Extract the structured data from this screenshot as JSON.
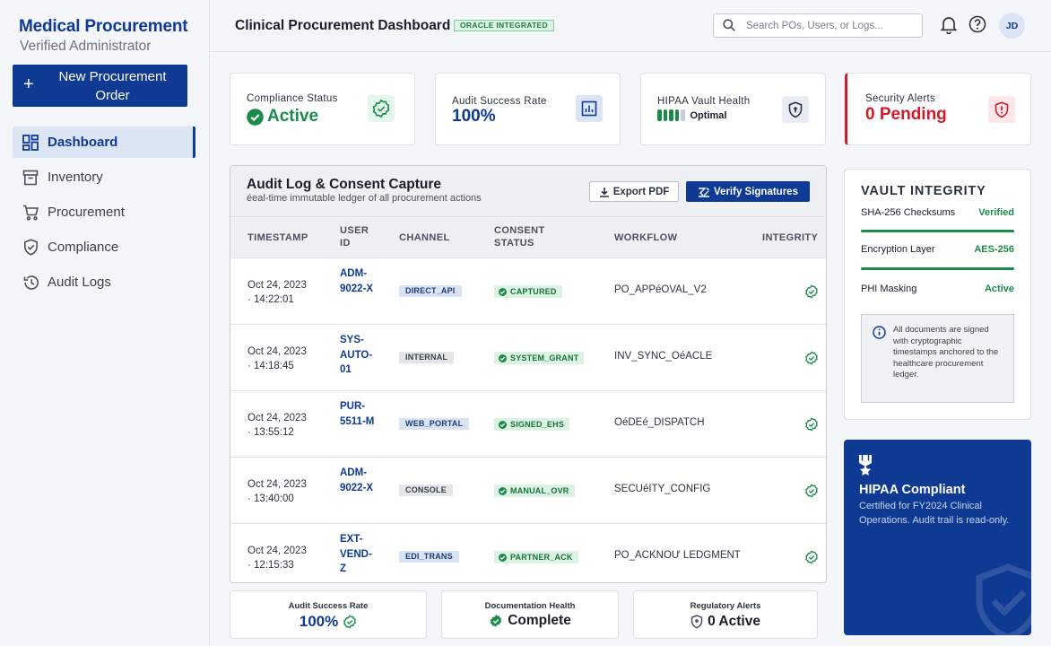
{
  "sidebar": {
    "brand_title": "Medical Procurement",
    "brand_subtitle": "Verified Administrator",
    "new_button": "New Procurement Order",
    "items": [
      {
        "label": "Dashboard",
        "icon": "dashboard-icon",
        "active": true
      },
      {
        "label": "Inventory",
        "icon": "inventory-icon"
      },
      {
        "label": "Procurement",
        "icon": "cart-icon"
      },
      {
        "label": "Compliance",
        "icon": "shield-check-icon"
      },
      {
        "label": "Audit Logs",
        "icon": "history-icon"
      }
    ]
  },
  "header": {
    "title": "Clinical Procurement Dashboard",
    "badge": "ORACLE INTEGRATED",
    "search_placeholder": "Search POs, Users, or Logs...",
    "avatar_initials": "JD"
  },
  "stats": {
    "compliance": {
      "label": "Compliance Status",
      "value": "Active"
    },
    "audit": {
      "label": "Audit Success Rate",
      "value": "100%"
    },
    "hipaa": {
      "label": "HIPAA Vault Health",
      "value": "Optimal",
      "level_segments": 4,
      "level_filled": 4
    },
    "alerts": {
      "label": "Security Alerts",
      "value": "0 Pending"
    }
  },
  "audit": {
    "title": "Audit Log & Consent Capture",
    "subtitle": "éeal-time immutable ledger of all procurement actions",
    "export_label": "Export PDF",
    "verify_label": "Verify Signatures",
    "columns": [
      "TIMESTAMP",
      "USER ID",
      "CHANNEL",
      "CONSENT STATUS",
      "WORKFLOW",
      "INTEGRITY"
    ],
    "rows": [
      {
        "date": "Oct 24, 2023",
        "time": "· 14:22:01",
        "user": "ADM-9022-X",
        "channel": "DIRECT_API",
        "channel_style": "blue",
        "consent": "CAPTURED",
        "workflow": "PO_APPéOVAL_V2"
      },
      {
        "date": "Oct 24, 2023",
        "time": "· 14:18:45",
        "user": "SYS-AUTO-01",
        "channel": "INTERNAL",
        "channel_style": "grey",
        "consent": "SYSTEM_GRANT",
        "workflow": "INV_SYNC_OéACLE"
      },
      {
        "date": "Oct 24, 2023",
        "time": "· 13:55:12",
        "user": "PUR-5511-M",
        "channel": "WEB_PORTAL",
        "channel_style": "blue",
        "consent": "SIGNED_EHS",
        "workflow": "OéDEé_DISPATCH"
      },
      {
        "date": "Oct 24, 2023",
        "time": "· 13:40:00",
        "user": "ADM-9022-X",
        "channel": "CONSOLE",
        "channel_style": "grey",
        "consent": "MANUAL_OVR",
        "workflow": "SECUéITY_CONFIG"
      },
      {
        "date": "Oct 24, 2023",
        "time": "· 12:15:33",
        "user": "EXT-VEND-Z",
        "channel": "EDI_TRANS",
        "channel_style": "blue",
        "consent": "PARTNER_ACK",
        "workflow": "PO_ACKNOƯ LEDGMENT"
      }
    ]
  },
  "metrics": {
    "audit": {
      "label": "Audit Success Rate",
      "value": "100%"
    },
    "docs": {
      "label": "Documentation Health",
      "value": "Complete"
    },
    "reg": {
      "label": "Regulatory Alerts",
      "value": "0 Active"
    }
  },
  "vault": {
    "title": "VAULT INTEGRITY",
    "rows": [
      {
        "label": "SHA-256 Checksums",
        "value": "Verified"
      },
      {
        "label": "Encryption Layer",
        "value": "AES-256"
      },
      {
        "label": "PHI Masking",
        "value": "Active"
      }
    ],
    "note": "All documents are signed with cryptographic timestamps anchored to the healthcare procurement ledger."
  },
  "hipaa_card": {
    "title": "HIPAA Compliant",
    "description": "Certified for FY2024 Clinical Operations. Audit trail is read-only."
  },
  "colors": {
    "brand": "#0f3a94",
    "success": "#1b8a4a",
    "danger": "#d11a2a"
  }
}
